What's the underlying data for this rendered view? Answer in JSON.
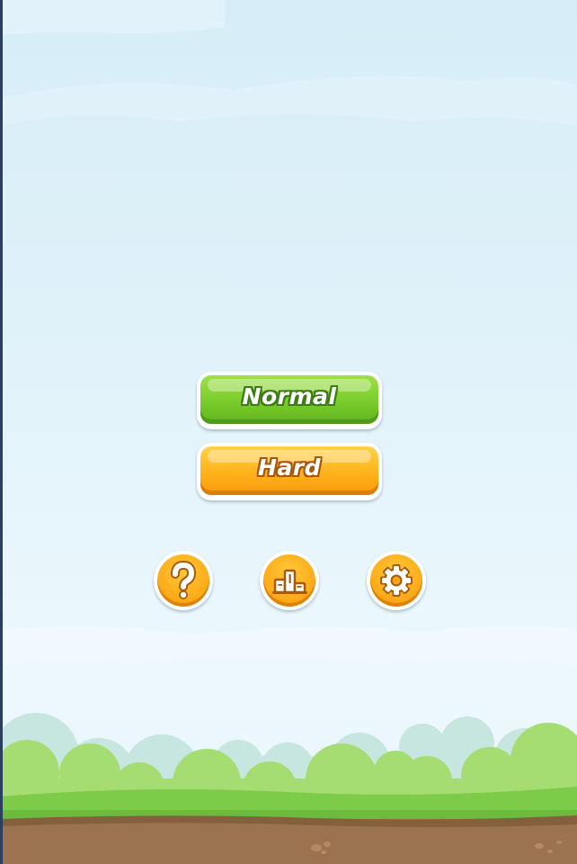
{
  "menu": {
    "normal_label": "Normal",
    "hard_label": "Hard"
  },
  "icons": {
    "help": "question-mark-icon",
    "leaderboard": "podium-icon",
    "settings": "gear-icon"
  },
  "colors": {
    "sky": "#dff1f9",
    "normal_button": "#7acc2c",
    "hard_button": "#ffb21a",
    "icon_button": "#ffae1c",
    "grass": "#7cc84a",
    "dirt": "#9c7350"
  }
}
